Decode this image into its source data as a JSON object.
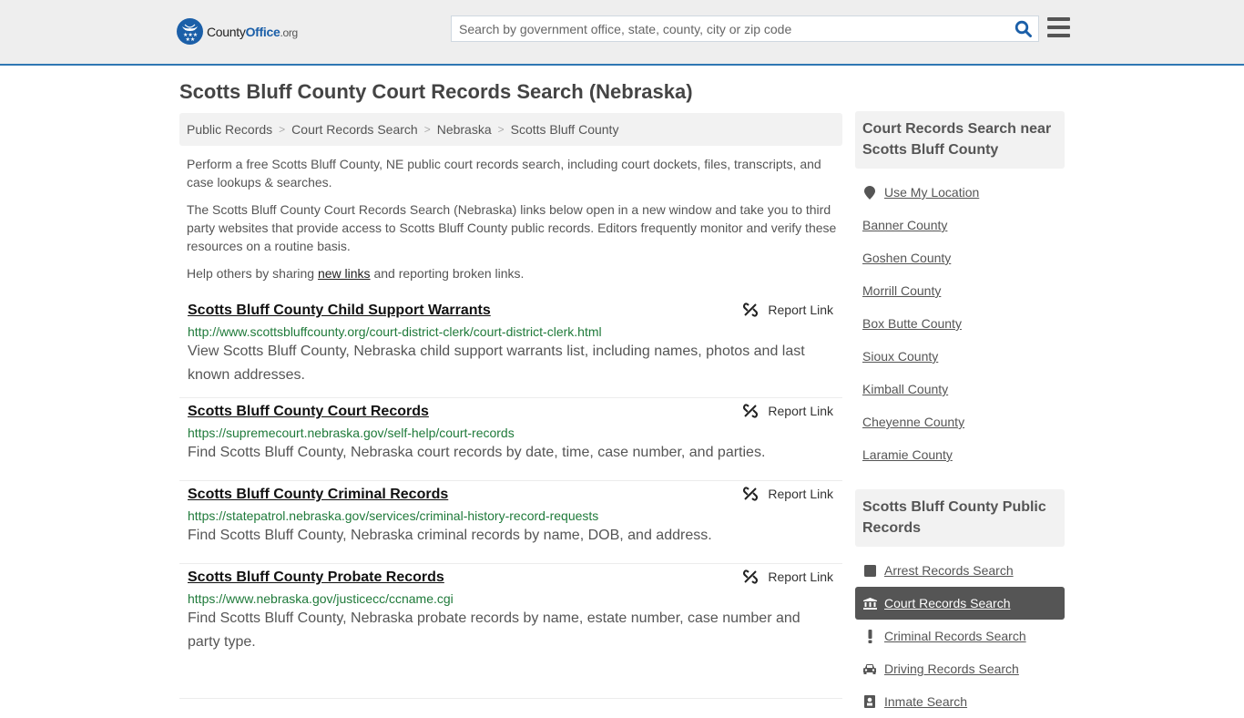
{
  "header": {
    "logo": {
      "name": "County",
      "office": "Office",
      "tld": ".org"
    },
    "search": {
      "placeholder": "Search by government office, state, county, city or zip code",
      "value": ""
    },
    "brand_color": "#1b5fa8",
    "accent_border": "#2f77b3"
  },
  "page": {
    "title": "Scotts Bluff County Court Records Search (Nebraska)"
  },
  "breadcrumb": [
    {
      "label": "Public Records"
    },
    {
      "label": "Court Records Search"
    },
    {
      "label": "Nebraska"
    },
    {
      "label": "Scotts Bluff County"
    }
  ],
  "intro": {
    "p1": "Perform a free Scotts Bluff County, NE public court records search, including court dockets, files, transcripts, and case lookups & searches.",
    "p2": "The Scotts Bluff County Court Records Search (Nebraska) links below open in a new window and take you to third party websites that provide access to Scotts Bluff County public records. Editors frequently monitor and verify these resources on a routine basis.",
    "p3_before": "Help others by sharing ",
    "p3_link": "new links",
    "p3_after": " and reporting broken links."
  },
  "links": [
    {
      "title": "Scotts Bluff County Child Support Warrants",
      "url": "http://www.scottsbluffcounty.org/court-district-clerk/court-district-clerk.html",
      "description": "View Scotts Bluff County, Nebraska child support warrants list, including names, photos and last known addresses.",
      "report_label": "Report Link"
    },
    {
      "title": "Scotts Bluff County Court Records",
      "url": "https://supremecourt.nebraska.gov/self-help/court-records",
      "description": "Find Scotts Bluff County, Nebraska court records by date, time, case number, and parties.",
      "report_label": "Report Link"
    },
    {
      "title": "Scotts Bluff County Criminal Records",
      "url": "https://statepatrol.nebraska.gov/services/criminal-history-record-requests",
      "description": "Find Scotts Bluff County, Nebraska criminal records by name, DOB, and address.",
      "report_label": "Report Link"
    },
    {
      "title": "Scotts Bluff County Probate Records",
      "url": "https://www.nebraska.gov/justicecc/ccname.cgi",
      "description": "Find Scotts Bluff County, Nebraska probate records by name, estate number, case number and party type.",
      "report_label": "Report Link"
    }
  ],
  "sidebar": {
    "near": {
      "heading": "Court Records Search near Scotts Bluff County",
      "use_location": "Use My Location",
      "counties": [
        "Banner County",
        "Goshen County",
        "Morrill County",
        "Box Butte County",
        "Sioux County",
        "Kimball County",
        "Cheyenne County",
        "Laramie County"
      ]
    },
    "public_records": {
      "heading": "Scotts Bluff County Public Records",
      "items": [
        {
          "label": "Arrest Records Search",
          "icon": "square-icon",
          "active": false
        },
        {
          "label": "Court Records Search",
          "icon": "courthouse-icon",
          "active": true
        },
        {
          "label": "Criminal Records Search",
          "icon": "exclamation-icon",
          "active": false
        },
        {
          "label": "Driving Records Search",
          "icon": "car-icon",
          "active": false
        },
        {
          "label": "Inmate Search",
          "icon": "inmate-icon",
          "active": false
        }
      ]
    }
  }
}
